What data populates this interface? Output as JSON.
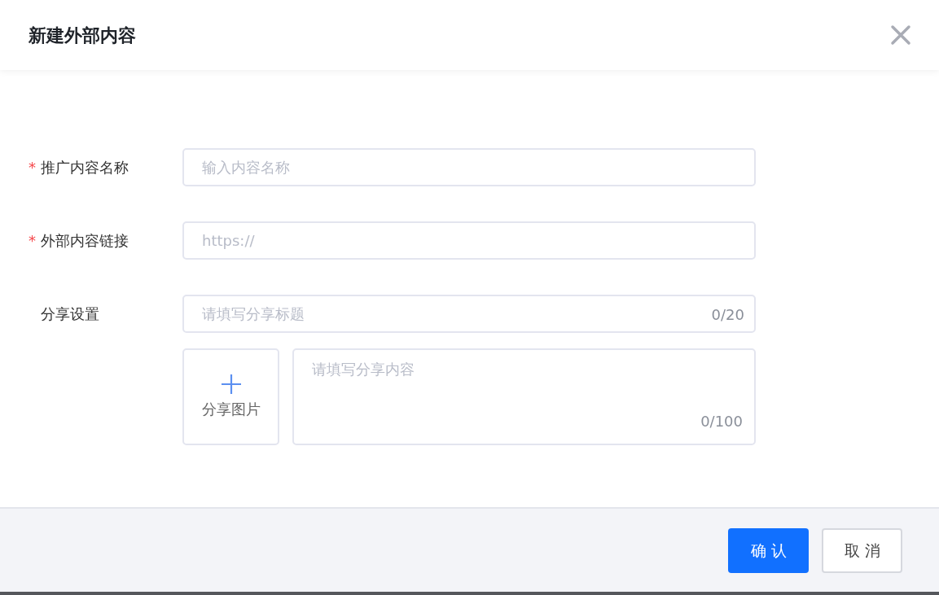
{
  "dialog": {
    "title": "新建外部内容"
  },
  "fields": [
    {
      "kind": "input",
      "mark": "*",
      "label": "推广内容名称",
      "placeholder": "输入内容名称"
    },
    {
      "kind": "input",
      "mark": "*",
      "label": "外部内容链接",
      "placeholder": "https://"
    },
    {
      "kind": "counted",
      "label": "分享设置",
      "placeholder": "请填写分享标题",
      "counter": "0/20"
    }
  ],
  "share_image": {
    "label": "分享图片"
  },
  "share_content": {
    "placeholder": "请填写分享内容",
    "counter": "0/100"
  },
  "buttons": [
    {
      "label": "确认",
      "kind": "primary"
    },
    {
      "label": "取消",
      "kind": "secondary"
    }
  ]
}
